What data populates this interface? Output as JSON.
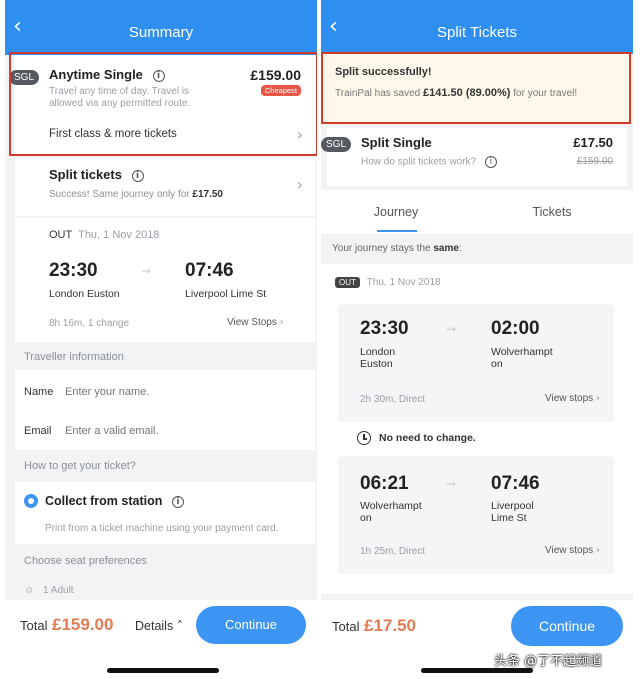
{
  "left": {
    "header_title": "Summary",
    "anytime": {
      "badge": "SGL",
      "title": "Anytime Single",
      "price": "£159.00",
      "tag": "Cheapest",
      "desc_line1": "Travel any time of day. Travel is",
      "desc_line2": "allowed via any permitted route.",
      "first_class": "First class & more tickets"
    },
    "split": {
      "title": "Split tickets",
      "desc": "Success! Same journey only for ",
      "price": "£17.50"
    },
    "journey": {
      "out_label": "OUT",
      "date": "Thu, 1 Nov 2018",
      "dep_time": "23:30",
      "arr_time": "07:46",
      "from": "London Euston",
      "to": "Liverpool Lime St",
      "duration": "8h 16m, 1 change",
      "view_stops": "View Stops"
    },
    "traveller_section": "Traveller information",
    "name_label": "Name",
    "name_placeholder": "Enter your name.",
    "email_label": "Email",
    "email_placeholder": "Enter a valid email.",
    "ticket_section": "How to get your ticket?",
    "collect_label": "Collect from station",
    "collect_desc": "Print from a ticket machine using your payment card.",
    "seat_section": "Choose seat preferences",
    "adult": "1 Adult",
    "total_label": "Total",
    "total_price": "£159.00",
    "details": "Details",
    "continue": "Continue"
  },
  "right": {
    "header_title": "Split Tickets",
    "success_title": "Split successfully!",
    "saved_prefix": "TrainPal has saved ",
    "saved_amount": "£141.50 (89.00%)",
    "saved_suffix": " for your travel!",
    "single": {
      "badge": "SGL",
      "title": "Split Single",
      "price": "£17.50",
      "old_price": "£159.00",
      "how": "How do split tickets work?"
    },
    "tabs": [
      "Journey",
      "Tickets"
    ],
    "stays_prefix": "Your journey stays the ",
    "stays_bold": "same",
    "stays_suffix": ":",
    "out_label": "OUT",
    "date": "Thu, 1 Nov 2018",
    "leg1": {
      "dep_time": "23:30",
      "arr_time": "02:00",
      "from1": "London",
      "from2": "Euston",
      "to1": "Wolverhampt",
      "to2": "on",
      "duration": "2h 30m, Direct",
      "view_stops": "View stops"
    },
    "no_change": "No need to change.",
    "leg2": {
      "dep_time": "06:21",
      "arr_time": "07:46",
      "from1": "Wolverhampt",
      "from2": "on",
      "to1": "Liverpool",
      "to2": "Lime St",
      "duration": "1h 25m, Direct",
      "view_stops": "View stops"
    },
    "total_label": "Total",
    "total_price": "£17.50",
    "continue": "Continue"
  },
  "watermark": "头条 @了不起频道",
  "colors": {
    "header": "#2f8ff0",
    "highlight": "#d43a2a",
    "price": "#e07b52",
    "button": "#3d95f3"
  }
}
